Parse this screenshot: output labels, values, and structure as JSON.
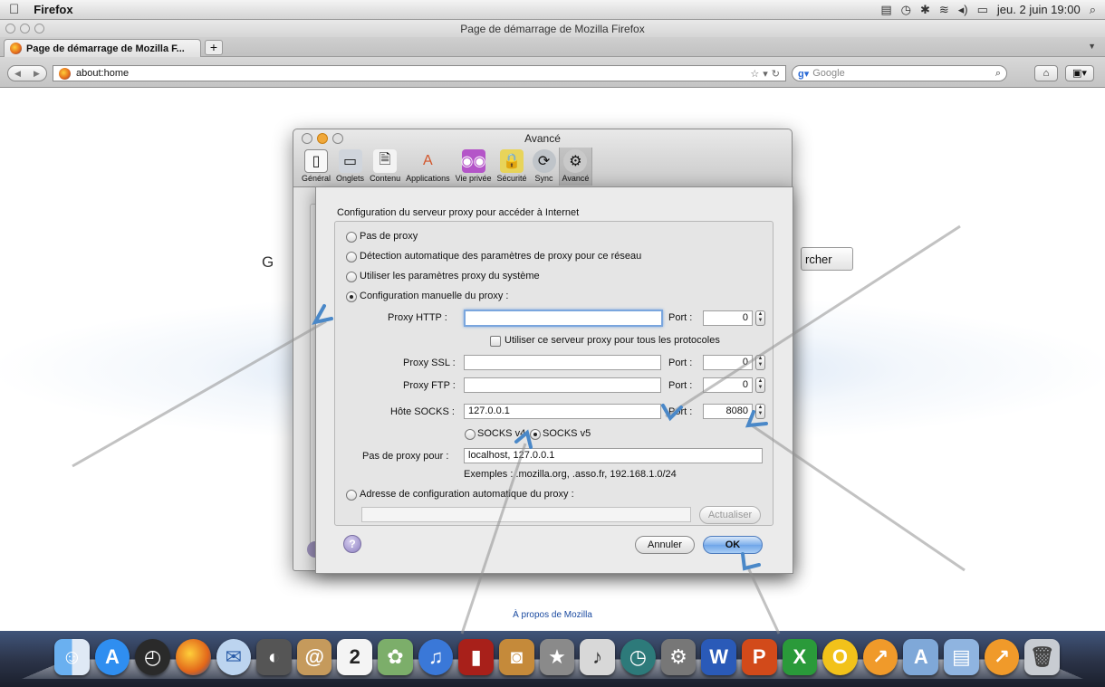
{
  "menubar": {
    "app_name": "Firefox",
    "clock": "jeu. 2 juin  19:00"
  },
  "browser": {
    "window_title": "Page de démarrage de Mozilla Firefox",
    "tab_label": "Page de démarrage de Mozilla F...",
    "new_tab": "+",
    "url": "about:home",
    "search_engine": "Google"
  },
  "page": {
    "google_partial": "G",
    "search_button_partial": "rcher",
    "about_link": "À propos de Mozilla"
  },
  "prefs": {
    "window_title": "Avancé",
    "toolbar": [
      {
        "label": "Général",
        "icon": "general-icon"
      },
      {
        "label": "Onglets",
        "icon": "tabs-icon"
      },
      {
        "label": "Contenu",
        "icon": "content-icon"
      },
      {
        "label": "Applications",
        "icon": "applications-icon"
      },
      {
        "label": "Vie privée",
        "icon": "privacy-mask-icon"
      },
      {
        "label": "Sécurité",
        "icon": "security-lock-icon"
      },
      {
        "label": "Sync",
        "icon": "sync-icon"
      },
      {
        "label": "Avancé",
        "icon": "advanced-gear-icon"
      }
    ]
  },
  "proxy": {
    "title": "Configuration du serveur proxy pour accéder à Internet",
    "options": {
      "none": "Pas de proxy",
      "auto_detect": "Détection automatique des paramètres de proxy pour ce réseau",
      "system": "Utiliser les paramètres proxy du système",
      "manual": "Configuration manuelle du proxy :",
      "pac": "Adresse de configuration automatique du proxy :"
    },
    "selected": "manual",
    "port_label": "Port :",
    "http": {
      "label": "Proxy HTTP :",
      "value": "",
      "port": "0"
    },
    "same_for_all": "Utiliser ce serveur proxy pour tous les protocoles",
    "ssl": {
      "label": "Proxy SSL :",
      "value": "",
      "port": "0"
    },
    "ftp": {
      "label": "Proxy FTP :",
      "value": "",
      "port": "0"
    },
    "socks": {
      "label": "Hôte SOCKS :",
      "value": "127.0.0.1",
      "port": "8080"
    },
    "socks_v4": "SOCKS v4",
    "socks_v5": "SOCKS v5",
    "socks_selected": "v5",
    "no_proxy": {
      "label": "Pas de proxy pour :",
      "value": "localhost, 127.0.0.1"
    },
    "examples": "Exemples : .mozilla.org, .asso.fr, 192.168.1.0/24",
    "pac_url": "",
    "reload": "Actualiser",
    "help": "?",
    "cancel": "Annuler",
    "ok": "OK"
  },
  "dock": {
    "items": [
      "Finder",
      "App Store",
      "Dashboard",
      "Firefox",
      "Mail",
      "FaceTime",
      "Contacts",
      "Calendar",
      "iPhoto",
      "iTunes",
      "Front Row",
      "Photo Booth",
      "iMovie",
      "GarageBand",
      "Time Machine",
      "System Preferences",
      "Word",
      "PowerPoint",
      "Excel",
      "OpenOffice",
      "Downloads",
      "Applications",
      "Documents",
      "Downloads Stack",
      "Trash"
    ],
    "calendar_day": "2"
  }
}
